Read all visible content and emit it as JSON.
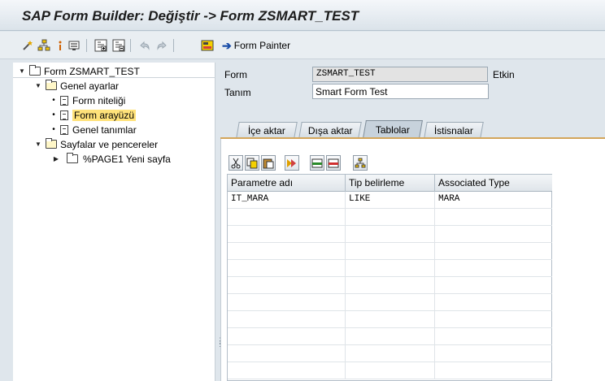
{
  "window": {
    "title": "SAP Form Builder: Değiştir -> Form ZSMART_TEST"
  },
  "toolbar": {
    "icons": [
      "wand-icon",
      "hierarchy-icon",
      "info-icon",
      "display-icon",
      "tree-expand-icon",
      "tree-collapse-icon",
      "undo-icon",
      "redo-icon",
      "painter-icon"
    ],
    "form_painter_label": "Form Painter"
  },
  "tree": {
    "root": "Form ZSMART_TEST",
    "general_settings": "Genel ayarlar",
    "form_attributes": "Form niteliği",
    "form_interface": "Form arayüzü",
    "global_definitions": "Genel tanımlar",
    "pages_windows": "Sayfalar ve pencereler",
    "page1": "%PAGE1  Yeni sayfa"
  },
  "header": {
    "form_label": "Form",
    "form_value": "ZSMART_TEST",
    "status": "Etkin",
    "desc_label": "Tanım",
    "desc_value": "Smart Form Test"
  },
  "tabs": [
    "İçe aktar",
    "Dışa aktar",
    "Tablolar",
    "İstisnalar"
  ],
  "active_tab": "Tablolar",
  "table": {
    "columns": [
      "Parametre adı",
      "Tip belirleme",
      "Associated Type"
    ],
    "rows": [
      [
        "IT_MARA",
        "LIKE",
        "MARA"
      ]
    ]
  },
  "colors": {
    "selected_highlight": "#ffe27a",
    "tab_accent": "#d3a55a"
  }
}
